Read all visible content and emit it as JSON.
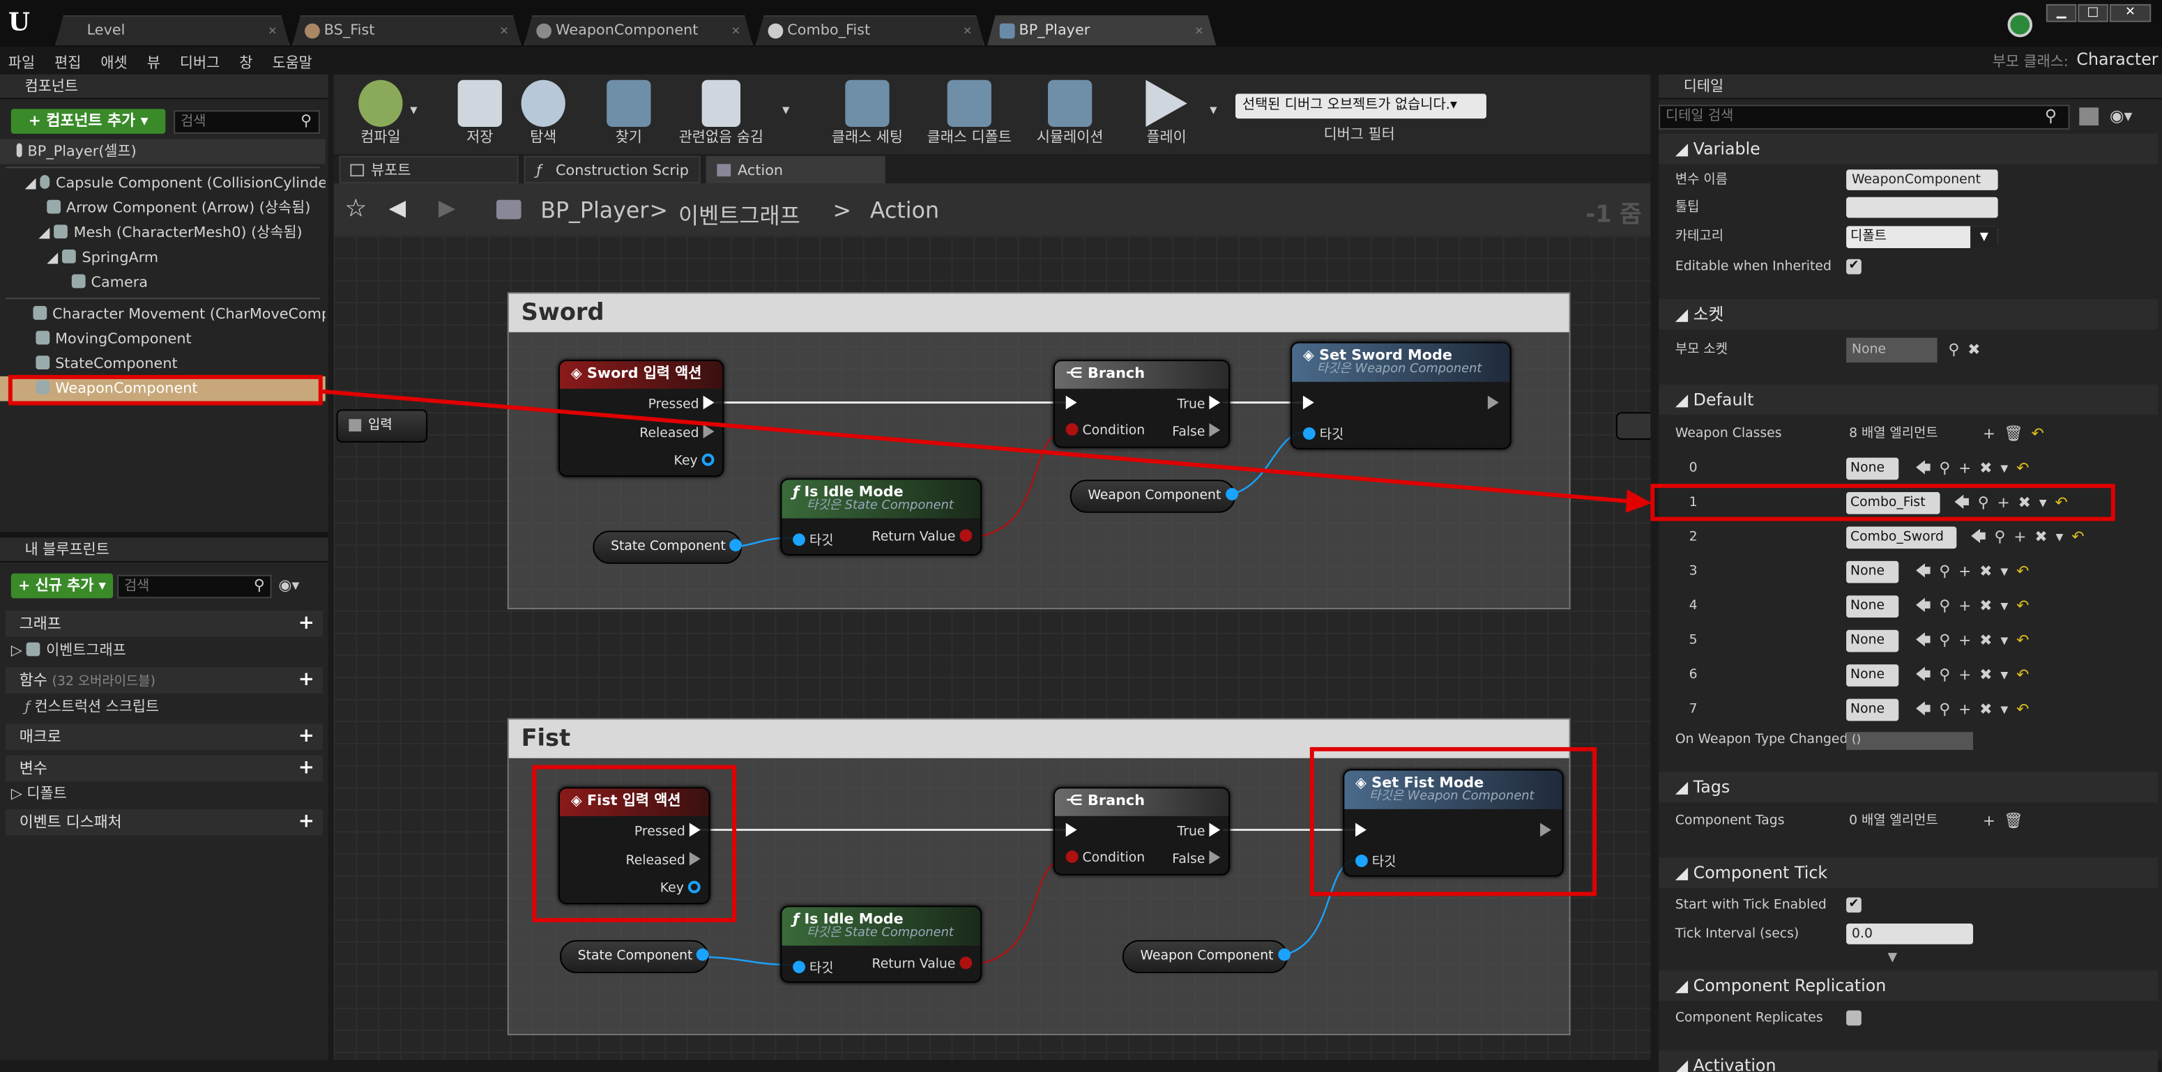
{
  "tabs": [
    {
      "label": "Level"
    },
    {
      "label": "BS_Fist"
    },
    {
      "label": "WeaponComponent"
    },
    {
      "label": "Combo_Fist"
    },
    {
      "label": "BP_Player"
    }
  ],
  "menu": [
    "파일",
    "편집",
    "애셋",
    "뷰",
    "디버그",
    "창",
    "도움말"
  ],
  "parent_class": {
    "label": "부모 클래스:",
    "value": "Character"
  },
  "components_panel": {
    "title": "컴포넌트",
    "add_button": "+ 컴포넌트 추가 ▾",
    "search_placeholder": "검색",
    "root": "BP_Player(셀프)",
    "items": [
      "Capsule Component (CollisionCylinder) (",
      "Arrow Component (Arrow) (상속됨)",
      "Mesh (CharacterMesh0) (상속됨)",
      "SpringArm",
      "Camera",
      "Character Movement (CharMoveComp) (",
      "MovingComponent",
      "StateComponent",
      "WeaponComponent"
    ]
  },
  "my_blueprint": {
    "title": "내 블루프린트",
    "add_button": "+ 신규 추가 ▾",
    "search_placeholder": "검색",
    "graph": "그래프",
    "event_graph": "이벤트그래프",
    "functions": "함수",
    "functions_note": "(32 오버라이드블)",
    "construction_script": "컨스트럭션 스크립트",
    "macros": "매크로",
    "variables": "변수",
    "defaults": "디폴트",
    "event_dispatchers": "이벤트 디스패처"
  },
  "toolbar": {
    "items": [
      "컴파일",
      "저장",
      "탐색",
      "찾기",
      "관련없음 숨김",
      "클래스 세팅",
      "클래스 디폴트",
      "시뮬레이션",
      "플레이"
    ],
    "debug_dropdown": "선택된 디버그 오브젝트가 없습니다.▾",
    "debug_filter": "디버그 필터"
  },
  "graph_tabs": [
    "뷰포트",
    "Construction Scrip",
    "Action"
  ],
  "breadcrumb": {
    "root": "BP_Player",
    "sep": ">",
    "graph": "이벤트그래프",
    "node": "Action",
    "zoom": "-1 줌"
  },
  "graph": {
    "input_node": "입력",
    "sword": {
      "title": "Sword",
      "event": "Sword 입력 액션",
      "pressed": "Pressed",
      "released": "Released",
      "key": "Key",
      "branch": "Branch",
      "condition": "Condition",
      "true": "True",
      "false": "False",
      "idle": "Is Idle Mode",
      "idle_sub": "타깃은 State Component",
      "target": "타깃",
      "return": "Return Value",
      "set_mode": "Set Sword Mode",
      "set_sub": "타깃은 Weapon Component",
      "state_var": "State Component",
      "weapon_var": "Weapon Component"
    },
    "fist": {
      "title": "Fist",
      "event": "Fist 입력 액션",
      "pressed": "Pressed",
      "released": "Released",
      "key": "Key",
      "branch": "Branch",
      "condition": "Condition",
      "true": "True",
      "false": "False",
      "idle": "Is Idle Mode",
      "idle_sub": "타깃은 State Component",
      "target": "타깃",
      "return": "Return Value",
      "set_mode": "Set Fist Mode",
      "set_sub": "타깃은 Weapon Component",
      "state_var": "State Component",
      "weapon_var": "Weapon Component"
    }
  },
  "details": {
    "title": "디테일",
    "search_placeholder": "디테일 검색",
    "variable": {
      "header": "Variable",
      "name_label": "변수 이름",
      "name_value": "WeaponComponent",
      "tooltip_label": "툴팁",
      "category_label": "카테고리",
      "category_value": "디폴트",
      "editable_label": "Editable when Inherited"
    },
    "socket": {
      "header": "소켓",
      "parent_label": "부모 소켓",
      "parent_value": "None"
    },
    "default": {
      "header": "Default",
      "weapon_classes_label": "Weapon Classes",
      "weapon_classes_count": "8 배열 엘리먼트",
      "entries": [
        {
          "index": "0",
          "value": "None"
        },
        {
          "index": "1",
          "value": "Combo_Fist"
        },
        {
          "index": "2",
          "value": "Combo_Sword"
        },
        {
          "index": "3",
          "value": "None"
        },
        {
          "index": "4",
          "value": "None"
        },
        {
          "index": "5",
          "value": "None"
        },
        {
          "index": "6",
          "value": "None"
        },
        {
          "index": "7",
          "value": "None"
        }
      ],
      "on_changed_label": "On Weapon Type Changed",
      "on_changed_value": "()"
    },
    "tags": {
      "header": "Tags",
      "label": "Component Tags",
      "value": "0 배열 엘리먼트"
    },
    "tick": {
      "header": "Component Tick",
      "start_label": "Start with Tick Enabled",
      "interval_label": "Tick Interval (secs)",
      "interval_value": "0.0"
    },
    "replication": {
      "header": "Component Replication",
      "label": "Component Replicates"
    },
    "activation": {
      "header": "Activation"
    }
  },
  "colors": {
    "highlight": "#e00000",
    "accent_green": "#3a8a2a",
    "selected_row": "#c8a87a"
  }
}
